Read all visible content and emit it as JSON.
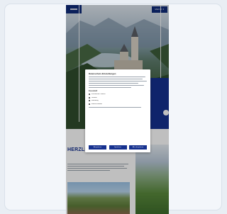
{
  "header": {
    "menu_label": "MENÜ  ≡",
    "logo_icon": "brand-logo-icon"
  },
  "colors": {
    "brand_blue": "#14308f",
    "background": "#e9eef4",
    "card": "#f3f6fa"
  },
  "cookie_modal": {
    "title": "Datenschutz-Einstellungen",
    "section_label": "Essenziell",
    "options": [
      "Essenzielle Cookies",
      "Statistik",
      "Marketing",
      "Externe Medien"
    ],
    "buttons": [
      "Akzeptieren",
      "Speichern",
      "Alle akzeptieren"
    ]
  },
  "main": {
    "section_title": "HERZLICH"
  },
  "icons": {
    "scroll": "circle-icon"
  }
}
